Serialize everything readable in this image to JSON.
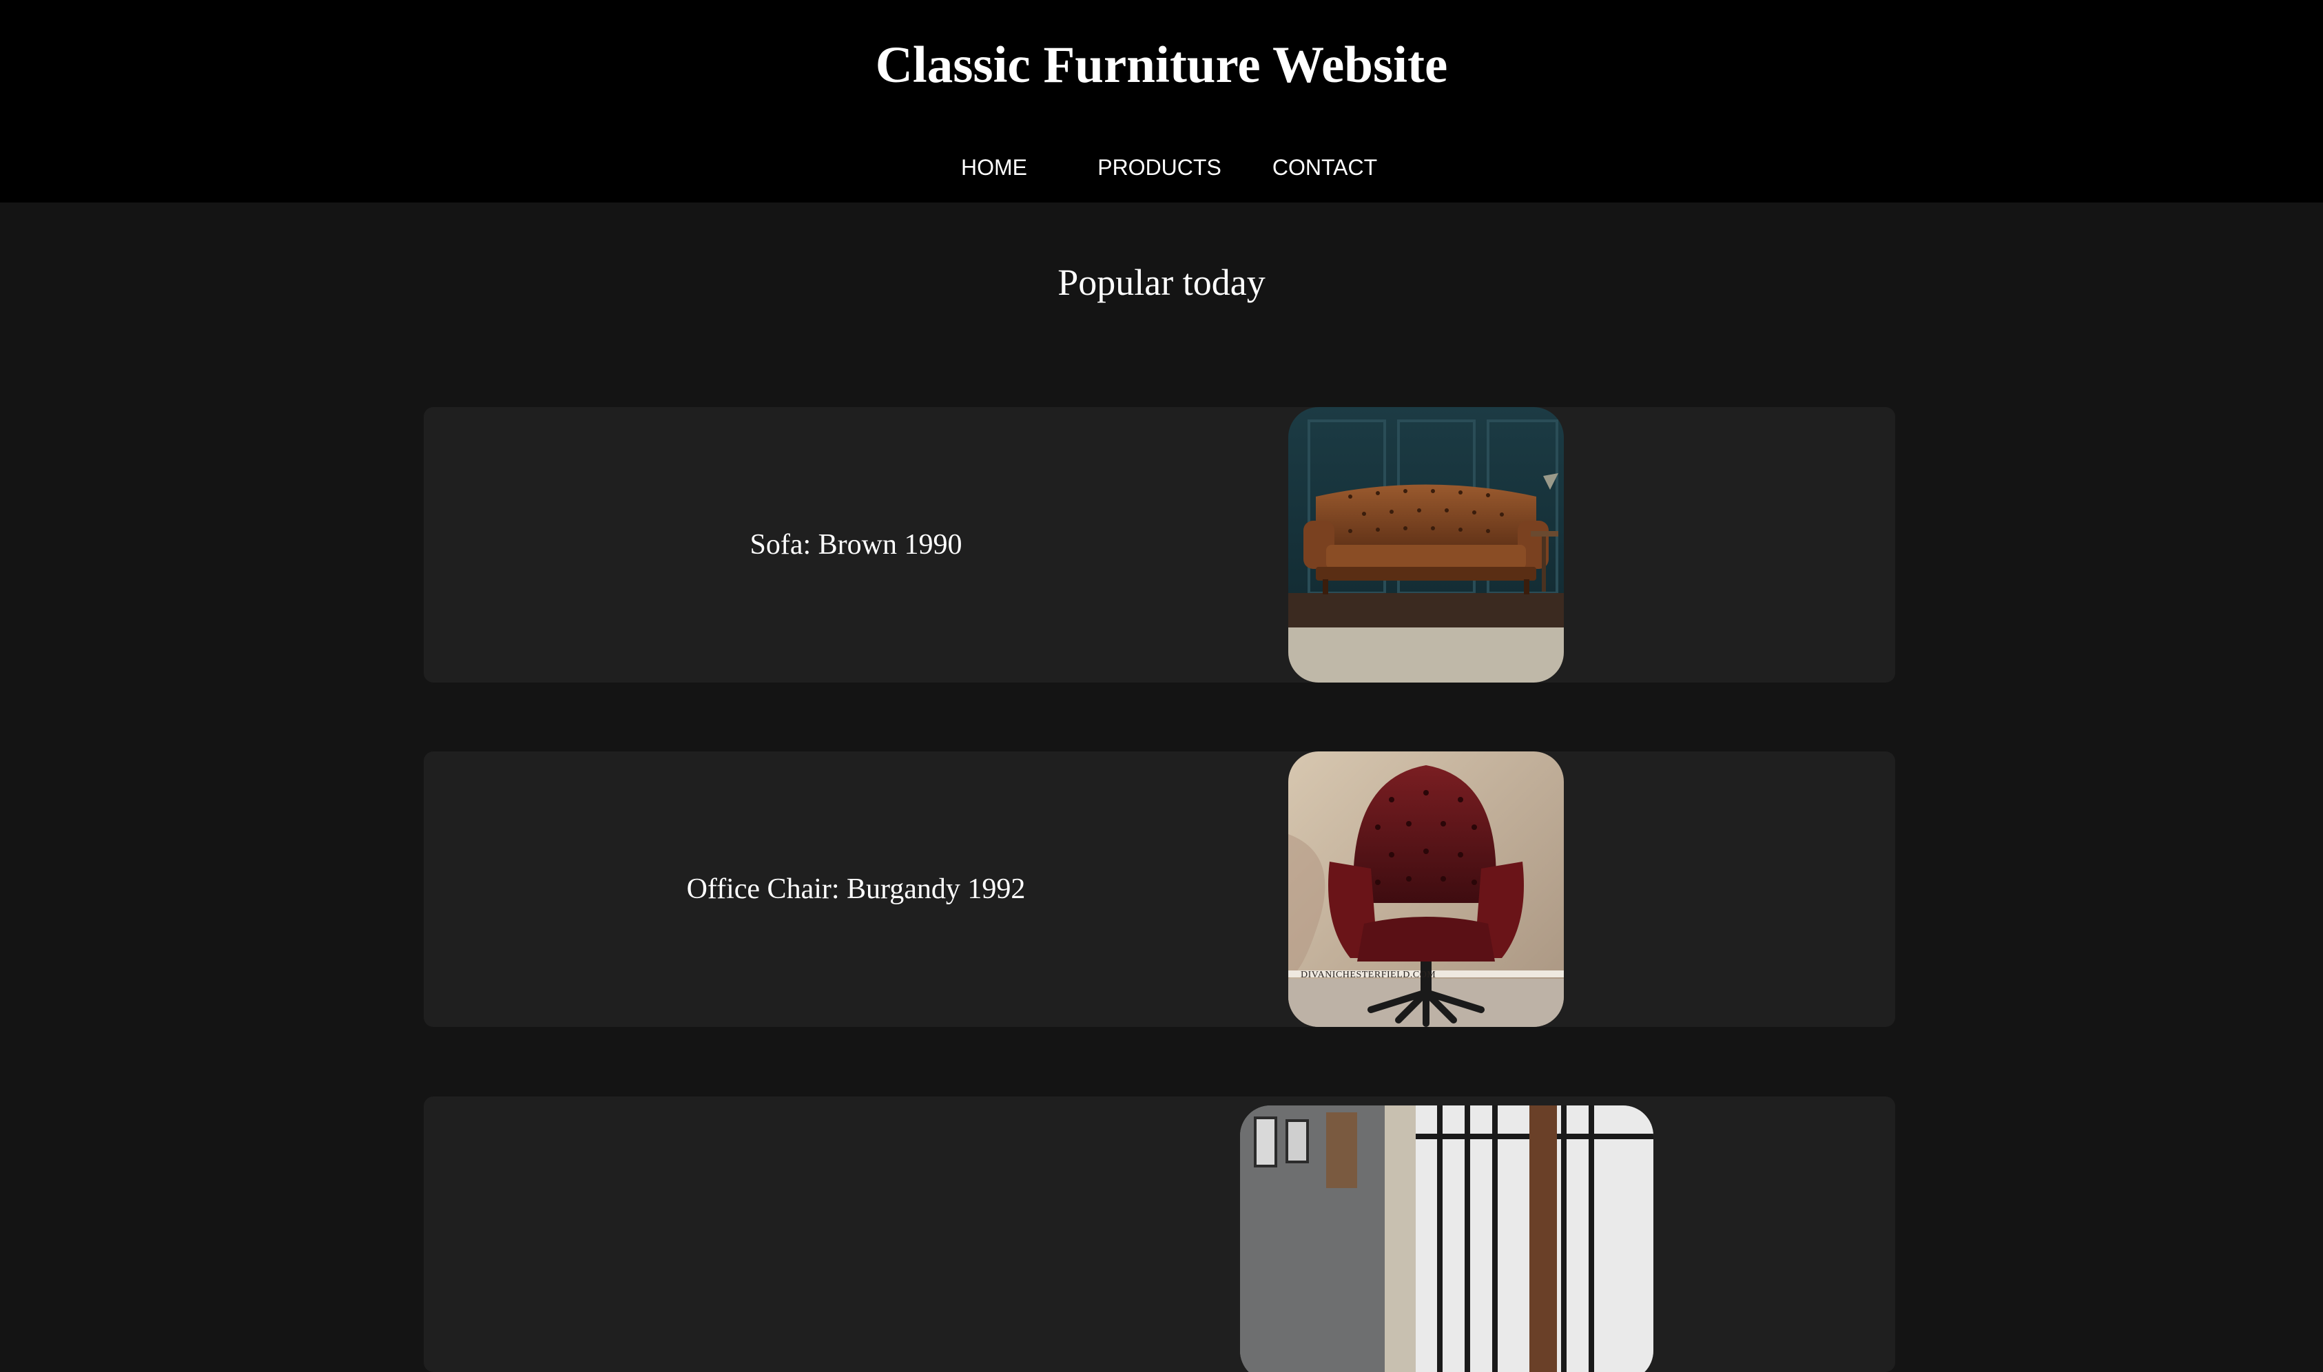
{
  "header": {
    "title": "Classic Furniture Website"
  },
  "nav": {
    "items": [
      {
        "label": "HOME"
      },
      {
        "label": "PRODUCTS"
      },
      {
        "label": "CONTACT"
      }
    ]
  },
  "main": {
    "section_title": "Popular today",
    "products": [
      {
        "label": "Sofa: Brown 1990",
        "image": "brown-tufted-leather-sofa"
      },
      {
        "label": "Office Chair: Burgandy 1992",
        "image": "burgundy-leather-office-chair",
        "image_watermark": "DIVANICHESTERFIELD.COM"
      },
      {
        "label": "",
        "image": "room-with-windows"
      }
    ]
  },
  "colors": {
    "header_bg": "#000000",
    "page_bg": "#141414",
    "card_bg": "#1f1f1f",
    "text": "#ffffff"
  }
}
